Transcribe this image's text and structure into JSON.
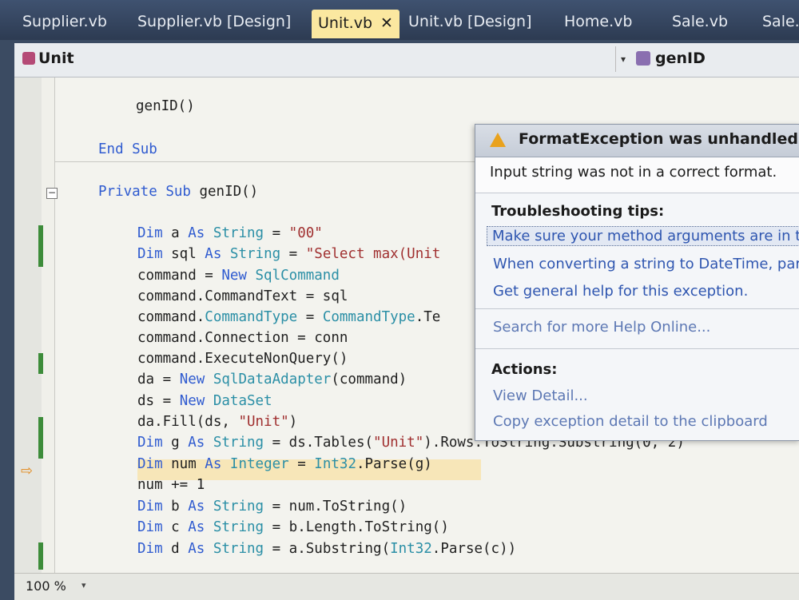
{
  "tabs": [
    {
      "label": "Supplier.vb"
    },
    {
      "label": "Supplier.vb [Design]"
    },
    {
      "label": "Unit.vb",
      "active": true,
      "close": "✕"
    },
    {
      "label": "Unit.vb [Design]"
    },
    {
      "label": "Home.vb"
    },
    {
      "label": "Sale.vb"
    },
    {
      "label": "Sale.v"
    }
  ],
  "navbar": {
    "class_name": "Unit",
    "member_name": "genID",
    "dropdown_glyph": "▾"
  },
  "editor": {
    "collapse_glyph": "−",
    "arrow_glyph": "⇨",
    "code_lines": [
      {
        "text": "genID()"
      },
      {
        "text": "End Sub"
      },
      {
        "text": "Private Sub genID()"
      },
      {
        "text": "Dim a As String = \"00\""
      },
      {
        "text": "Dim sql As String = \"Select max(Unit"
      },
      {
        "text": "command = New SqlCommand"
      },
      {
        "text": "command.CommandText = sql"
      },
      {
        "text": "command.CommandType = CommandType.Te"
      },
      {
        "text": "command.Connection = conn"
      },
      {
        "text": "command.ExecuteNonQuery()"
      },
      {
        "text": "da = New SqlDataAdapter(command)"
      },
      {
        "text": "ds = New DataSet"
      },
      {
        "text": "da.Fill(ds, \"Unit\")"
      },
      {
        "text": "Dim g As String = ds.Tables(\"Unit\").Rows.ToString.Substring(0, 2)"
      },
      {
        "text": "Dim num As Integer = Int32.Parse(g)"
      },
      {
        "text": "num += 1"
      },
      {
        "text": "Dim b As String = num.ToString()"
      },
      {
        "text": "Dim c As String = b.Length.ToString()"
      },
      {
        "text": "Dim d As String = a.Substring(Int32.Parse(c))"
      }
    ]
  },
  "exception_popup": {
    "title": "FormatException was unhandled",
    "message": "Input string was not in a correct format.",
    "tips_header": "Troubleshooting tips:",
    "tips": [
      "Make sure your method arguments are in t",
      "When converting a string to DateTime, par",
      "Get general help for this exception."
    ],
    "search_link": "Search for more Help Online...",
    "actions_header": "Actions:",
    "actions": [
      "View Detail...",
      "Copy exception detail to the clipboard"
    ]
  },
  "status": {
    "zoom": "100 %",
    "zoom_glyph": "▾"
  },
  "colors": {
    "tab_active": "#fbe8a0",
    "keyword": "#2f5bd0",
    "type": "#2b8fa6",
    "link": "#2f56b0",
    "change_bar": "#3d8c3a"
  }
}
